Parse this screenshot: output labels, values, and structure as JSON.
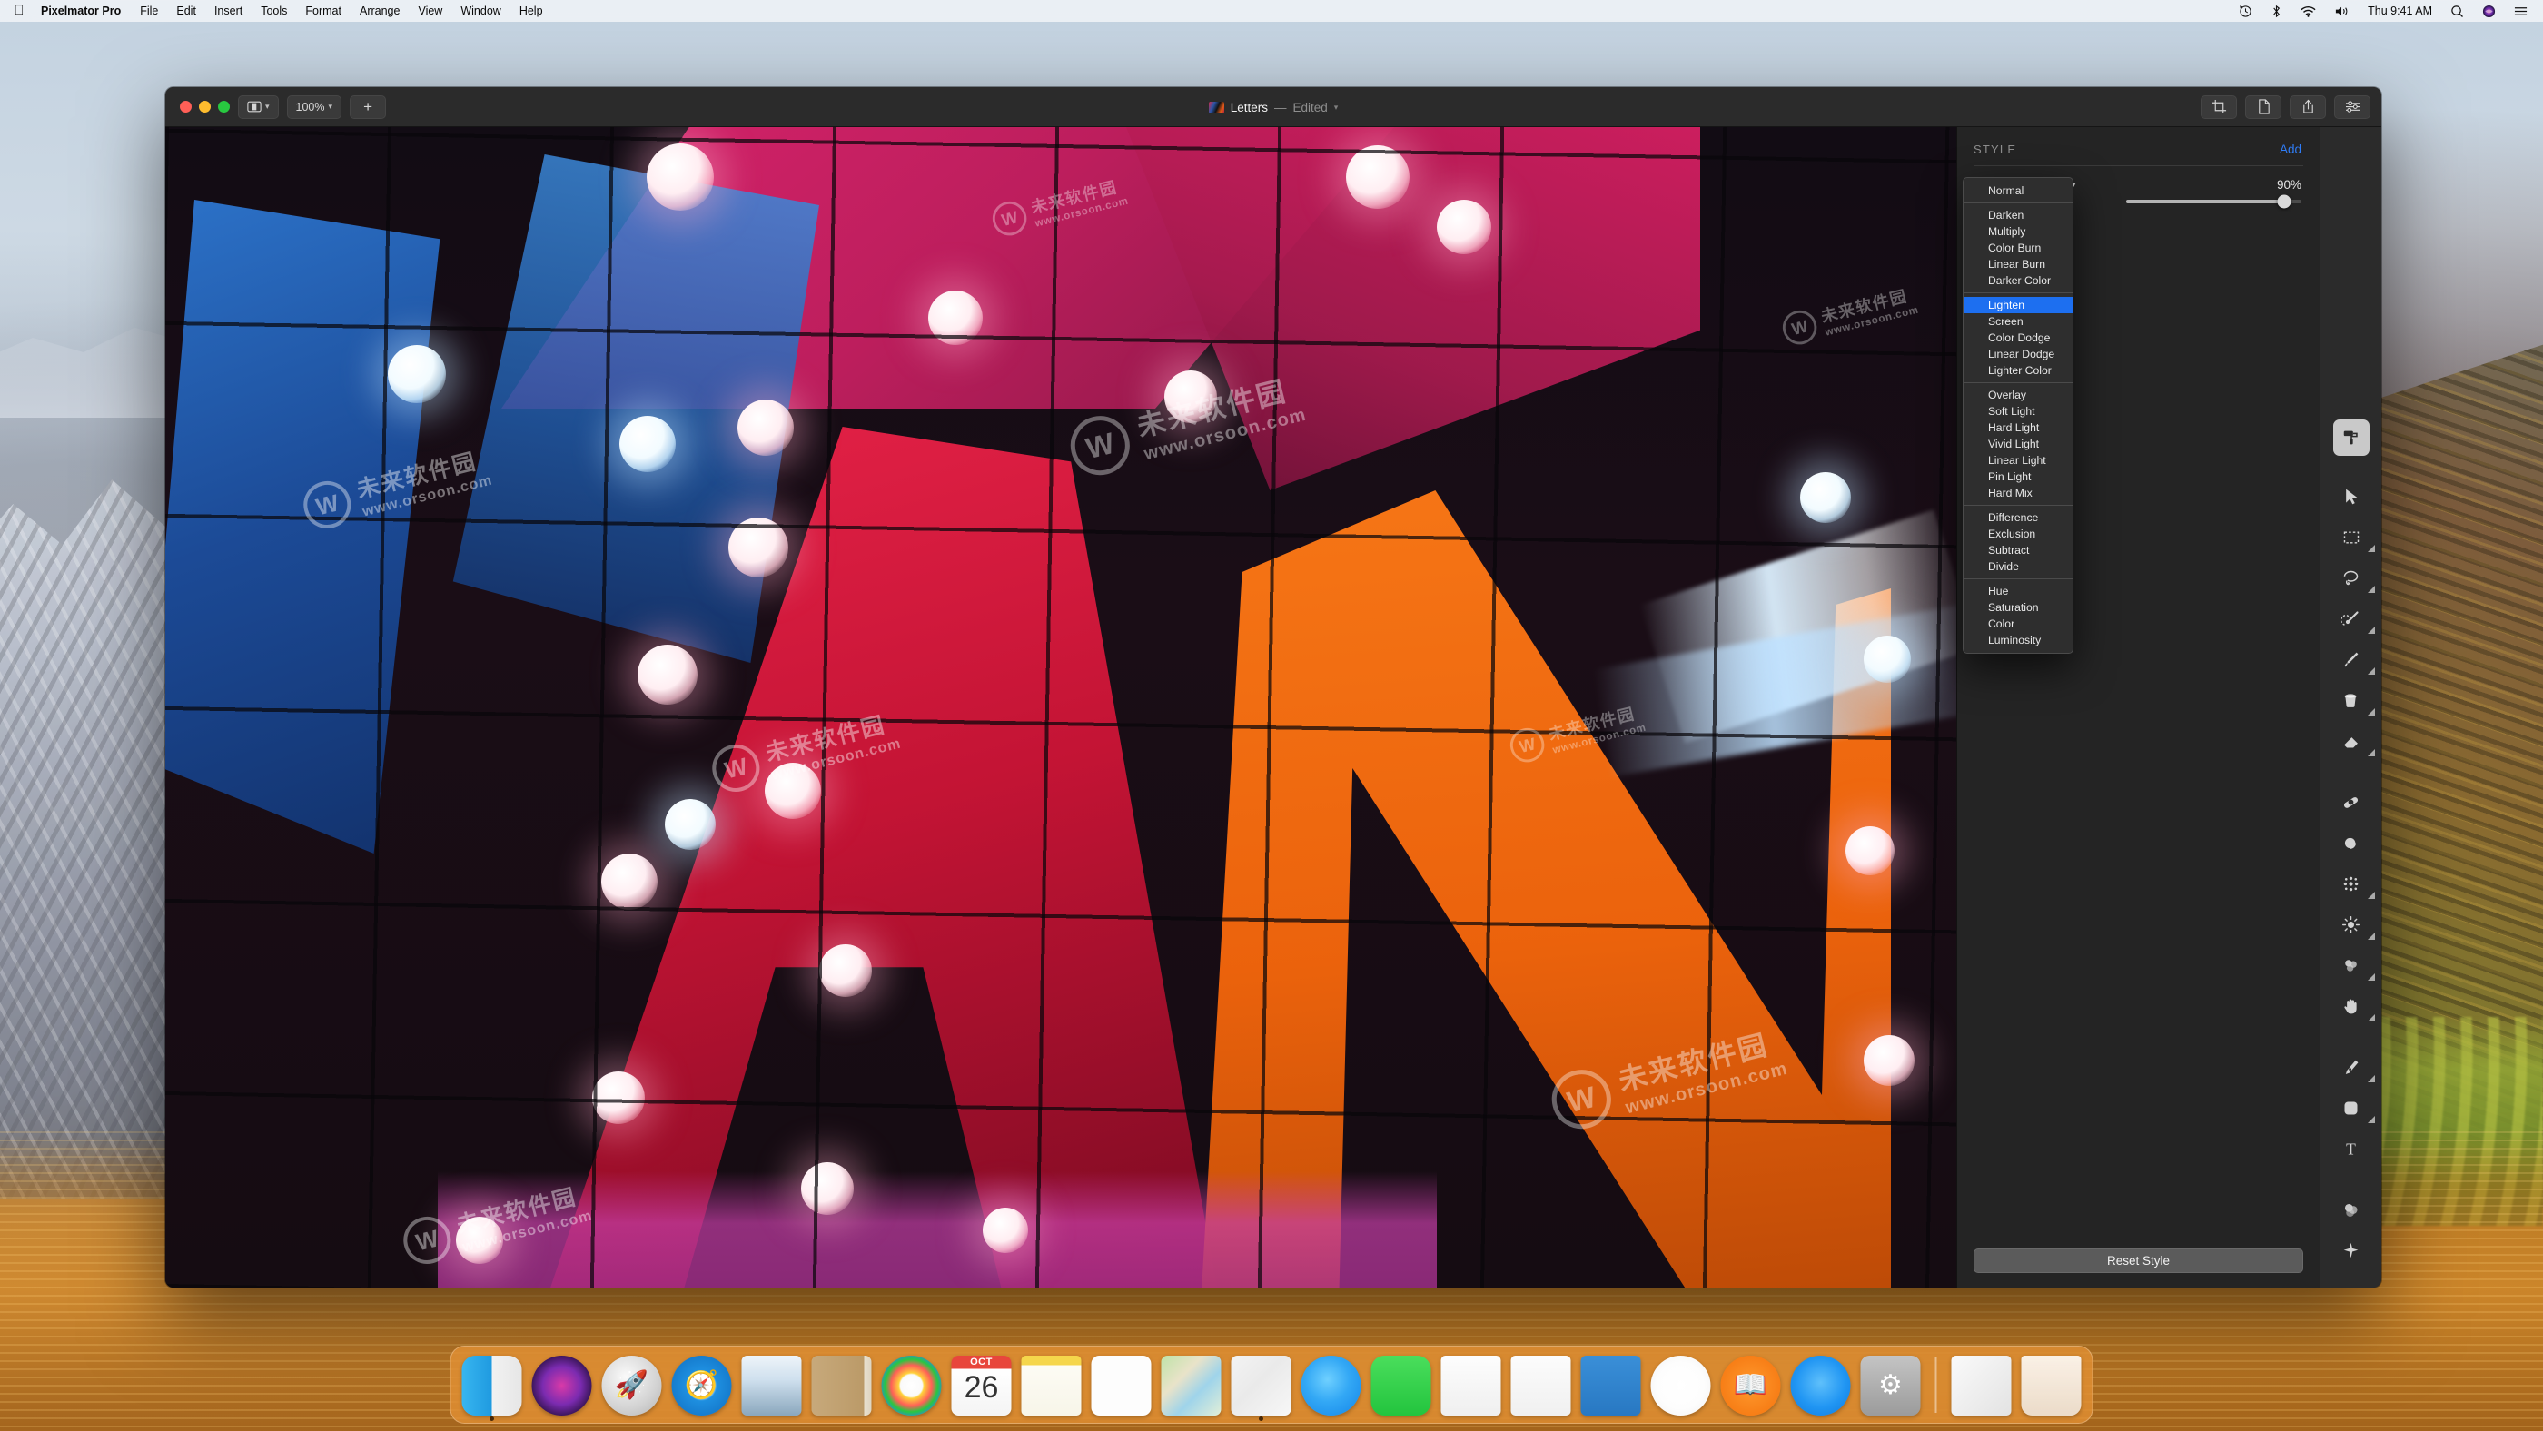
{
  "menubar": {
    "apple_icon": "apple-logo",
    "app_name": "Pixelmator Pro",
    "items": [
      "File",
      "Edit",
      "Insert",
      "Tools",
      "Format",
      "Arrange",
      "View",
      "Window",
      "Help"
    ],
    "status_icons": [
      "time-machine-icon",
      "bluetooth-icon",
      "wifi-icon",
      "volume-icon"
    ],
    "clock": "Thu 9:41 AM",
    "trailing_icons": [
      "search-icon",
      "siri-icon",
      "control-center-icon"
    ]
  },
  "window": {
    "title": "Letters",
    "dash": "—",
    "edited": "Edited",
    "traffic": [
      "close",
      "minimize",
      "zoom"
    ],
    "left_toolbar": [
      {
        "name": "sidebar-toggle",
        "label": "",
        "icon": "sidebar-icon",
        "chevron": true
      },
      {
        "name": "zoom-level",
        "label": "100%",
        "icon": "",
        "chevron": true
      },
      {
        "name": "add-layer",
        "label": "+",
        "icon": "plus-icon",
        "chevron": false
      }
    ],
    "right_toolbar": [
      {
        "name": "crop-button",
        "icon": "crop-icon"
      },
      {
        "name": "new-document-button",
        "icon": "document-icon"
      },
      {
        "name": "share-button",
        "icon": "share-icon"
      },
      {
        "name": "adjustments-button",
        "icon": "sliders-icon"
      }
    ]
  },
  "inspector": {
    "title": "STYLE",
    "add_label": "Add",
    "opacity_label": "Opacity (Normal)",
    "opacity_value": "90%",
    "opacity_percent": 90,
    "reset_label": "Reset Style",
    "accent_color": "#2f7cf6",
    "selection_color": "#1d6ff0"
  },
  "blend_popup": {
    "selected": "Lighten",
    "groups": [
      [
        "Normal"
      ],
      [
        "Darken",
        "Multiply",
        "Color Burn",
        "Linear Burn",
        "Darker Color"
      ],
      [
        "Lighten",
        "Screen",
        "Color Dodge",
        "Linear Dodge",
        "Lighter Color"
      ],
      [
        "Overlay",
        "Soft Light",
        "Hard Light",
        "Vivid Light",
        "Linear Light",
        "Pin Light",
        "Hard Mix"
      ],
      [
        "Difference",
        "Exclusion",
        "Subtract",
        "Divide"
      ],
      [
        "Hue",
        "Saturation",
        "Color",
        "Luminosity"
      ]
    ]
  },
  "swatches": [
    {
      "name": "swatch-crimson",
      "color": "#ef0f3e"
    },
    {
      "name": "swatch-khaki",
      "color": "#cdc59a"
    },
    {
      "name": "swatch-blue",
      "color": "#1f5289"
    },
    {
      "name": "swatch-silver",
      "color": "#b8b8b8"
    },
    {
      "name": "swatch-pink",
      "color": "#d8559b"
    },
    {
      "name": "swatch-orange",
      "color": "#ff9108"
    },
    {
      "name": "swatch-steel",
      "color": "#7e9aac"
    },
    {
      "name": "swatch-cyan",
      "color": "#4fe2f0"
    },
    {
      "name": "swatch-magenta",
      "color": "#c60256"
    },
    {
      "name": "swatch-purple",
      "color": "#b43bff"
    },
    {
      "name": "swatch-slate",
      "color": "#5f6e8c"
    },
    {
      "name": "swatch-vermilion",
      "color": "#e8441c"
    }
  ],
  "tools": [
    {
      "name": "tool-style",
      "icon": "paint-roller-icon",
      "active": true,
      "submenu": false
    },
    {
      "name": "tool-arrange",
      "icon": "arrow-cursor-icon",
      "active": false,
      "submenu": false
    },
    {
      "name": "tool-marquee",
      "icon": "marquee-icon",
      "active": false,
      "submenu": true
    },
    {
      "name": "tool-free-select",
      "icon": "lasso-icon",
      "active": false,
      "submenu": true
    },
    {
      "name": "tool-magic-wand",
      "icon": "magic-wand-icon",
      "active": false,
      "submenu": true
    },
    {
      "name": "tool-paint",
      "icon": "paintbrush-icon",
      "active": false,
      "submenu": true
    },
    {
      "name": "tool-color-fill",
      "icon": "paint-bucket-icon",
      "active": false,
      "submenu": true
    },
    {
      "name": "tool-eraser",
      "icon": "eraser-icon",
      "active": false,
      "submenu": true
    },
    {
      "name": "tool-repair",
      "icon": "bandage-icon",
      "active": false,
      "submenu": false
    },
    {
      "name": "tool-smudge",
      "icon": "smudge-icon",
      "active": false,
      "submenu": false
    },
    {
      "name": "tool-halftone",
      "icon": "halftone-icon",
      "active": false,
      "submenu": true
    },
    {
      "name": "tool-lighten",
      "icon": "sun-icon",
      "active": false,
      "submenu": true
    },
    {
      "name": "tool-blur",
      "icon": "blur-icon",
      "active": false,
      "submenu": true
    },
    {
      "name": "tool-hand",
      "icon": "hand-icon",
      "active": false,
      "submenu": true
    },
    {
      "name": "tool-pen",
      "icon": "pen-nib-icon",
      "active": false,
      "submenu": true
    },
    {
      "name": "tool-shape",
      "icon": "rounded-square-icon",
      "active": false,
      "submenu": true
    },
    {
      "name": "tool-type",
      "icon": "text-t-icon",
      "active": false,
      "submenu": false
    },
    {
      "name": "tool-color-adjust",
      "icon": "color-circles-icon",
      "active": false,
      "submenu": false
    },
    {
      "name": "tool-effects",
      "icon": "effects-icon",
      "active": false,
      "submenu": false
    }
  ],
  "canvas": {
    "watermark_cn": "未来软件园",
    "watermark_url": "www.orsoon.com",
    "watermark_logo": "W"
  },
  "dock": {
    "items": [
      {
        "name": "dock-finder",
        "label": "Finder",
        "cls": "di-finder",
        "shape": "sq",
        "running": true,
        "glyph": ""
      },
      {
        "name": "dock-siri",
        "label": "Siri",
        "cls": "di-siri",
        "shape": "circ",
        "running": false,
        "glyph": ""
      },
      {
        "name": "dock-launchpad",
        "label": "Launchpad",
        "cls": "di-launchpad",
        "shape": "circ",
        "running": false,
        "glyph": "🚀"
      },
      {
        "name": "dock-safari",
        "label": "Safari",
        "cls": "di-safari",
        "shape": "circ",
        "running": false,
        "glyph": "🧭"
      },
      {
        "name": "dock-mail",
        "label": "Mail",
        "cls": "di-mail",
        "shape": "sq",
        "running": false,
        "glyph": ""
      },
      {
        "name": "dock-contacts",
        "label": "Contacts",
        "cls": "di-contacts",
        "shape": "sq",
        "running": false,
        "glyph": ""
      },
      {
        "name": "dock-photos",
        "label": "Photos",
        "cls": "di-photos",
        "shape": "circ",
        "running": false,
        "glyph": ""
      },
      {
        "name": "dock-calendar",
        "label": "Calendar",
        "cls": "di-calendar",
        "shape": "sq",
        "running": false,
        "glyph": "",
        "month": "OCT",
        "day": "26"
      },
      {
        "name": "dock-notes",
        "label": "Notes",
        "cls": "di-notes",
        "shape": "sq",
        "running": false,
        "glyph": ""
      },
      {
        "name": "dock-reminders",
        "label": "Reminders",
        "cls": "di-reminders",
        "shape": "sq",
        "running": false,
        "glyph": ""
      },
      {
        "name": "dock-maps",
        "label": "Maps",
        "cls": "di-maps",
        "shape": "sq",
        "running": false,
        "glyph": ""
      },
      {
        "name": "dock-pixelmator-pro",
        "label": "Pixelmator Pro",
        "cls": "di-pixelmator",
        "shape": "sq",
        "running": true,
        "glyph": ""
      },
      {
        "name": "dock-messages",
        "label": "Messages",
        "cls": "di-messages",
        "shape": "circ",
        "running": false,
        "glyph": ""
      },
      {
        "name": "dock-facetime",
        "label": "FaceTime",
        "cls": "di-facetime",
        "shape": "sq",
        "running": false,
        "glyph": ""
      },
      {
        "name": "dock-pages",
        "label": "Pages",
        "cls": "di-pages",
        "shape": "sq",
        "running": false,
        "glyph": ""
      },
      {
        "name": "dock-numbers",
        "label": "Numbers",
        "cls": "di-numbers",
        "shape": "sq",
        "running": false,
        "glyph": ""
      },
      {
        "name": "dock-keynote",
        "label": "Keynote",
        "cls": "di-keynote",
        "shape": "sq",
        "running": false,
        "glyph": ""
      },
      {
        "name": "dock-itunes",
        "label": "iTunes",
        "cls": "di-itunes",
        "shape": "circ",
        "running": false,
        "glyph": ""
      },
      {
        "name": "dock-books",
        "label": "Books",
        "cls": "di-books",
        "shape": "circ",
        "running": false,
        "glyph": "📖"
      },
      {
        "name": "dock-app-store",
        "label": "App Store",
        "cls": "di-appstore",
        "shape": "circ",
        "running": false,
        "glyph": ""
      },
      {
        "name": "dock-system-preferences",
        "label": "System Preferences",
        "cls": "di-sysprefs",
        "shape": "sq",
        "running": false,
        "glyph": "⚙"
      }
    ],
    "right_items": [
      {
        "name": "dock-downloads",
        "label": "Downloads",
        "cls": "di-downloads",
        "shape": "sq"
      },
      {
        "name": "dock-trash",
        "label": "Trash",
        "cls": "di-trash",
        "shape": "sq"
      }
    ]
  }
}
